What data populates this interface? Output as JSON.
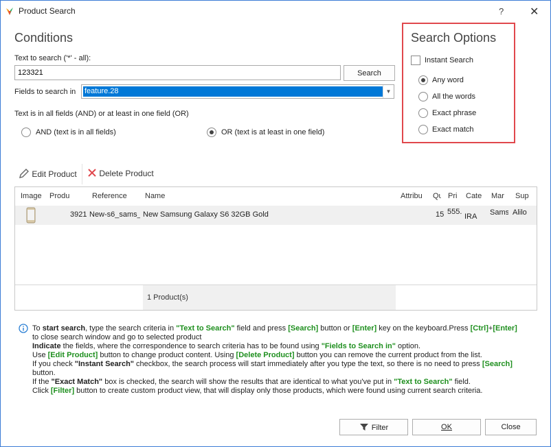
{
  "window": {
    "title": "Product Search",
    "help_label": "?",
    "close_label": "✕"
  },
  "conditions": {
    "title": "Conditions",
    "text_label": "Text to search ('*' - all):",
    "text_value": "123321",
    "search_button": "Search",
    "fields_label": "Fields to search in",
    "fields_value": "feature.28",
    "logic_label": "Text is in all fields (AND) or at least in one field (OR)",
    "and_label": "AND (text is in all fields)",
    "or_label": "OR (text is at least in one field)",
    "selected_logic": "OR"
  },
  "search_options": {
    "title": "Search Options",
    "instant_search": "Instant Search",
    "instant_checked": false,
    "modes": [
      "Any word",
      "All the words",
      "Exact phrase",
      "Exact match"
    ],
    "selected_mode": "Any word",
    "highlight_color": "#e0474c"
  },
  "toolbar": {
    "edit_label": "Edit Product",
    "delete_label": "Delete Product"
  },
  "grid": {
    "columns": [
      "Image",
      "Produ",
      "Reference",
      "Name",
      "Attribu",
      "Qu",
      "Pri",
      "Cate",
      "Mar",
      "Sup"
    ],
    "rows": [
      {
        "image": "phone-thumbnail",
        "product": "3921",
        "reference": "New-s6_sams_",
        "name": "New Samsung Galaxy S6 32GB Gold",
        "attribute": "",
        "qty": "15",
        "price": "555.",
        "category": "IRA",
        "manufacturer": "Sams",
        "supplier": "Alilo"
      }
    ],
    "footer": "1 Product(s)"
  },
  "help": {
    "l1": [
      "To ",
      "start search",
      ", type the search criteria in ",
      "\"Text to Search\"",
      " field and press ",
      "[Search]",
      " button or ",
      "[Enter]",
      " key on the keyboard.Press ",
      "[Ctrl]",
      "+",
      "[Enter]"
    ],
    "l2": "to close search window and go to selected product",
    "l3": [
      "Indicate",
      " the fields, where the correspondence to search criteria has to be found using ",
      "\"Fields to Search in\"",
      " option."
    ],
    "l4": [
      "Use ",
      "[Edit Product]",
      " button to change product content. Using ",
      "[Delete Product]",
      " button you can remove the current product from the list."
    ],
    "l5": [
      "If you check ",
      "\"Instant Search\"",
      " checkbox, the search process will start immediately after you type the text, so there is no need to press ",
      "[Search]"
    ],
    "l6": "button.",
    "l7": [
      "If the ",
      "\"Exact Match\"",
      " box is checked, the search will show the results that are identical to what you've put in ",
      "\"Text to Search\"",
      " field."
    ],
    "l8": [
      "Click ",
      "[Filter]",
      " button to create custom product view, that will display only those products, which were found using current search criteria."
    ]
  },
  "buttons": {
    "filter": "Filter",
    "ok": "OK",
    "close": "Close"
  }
}
